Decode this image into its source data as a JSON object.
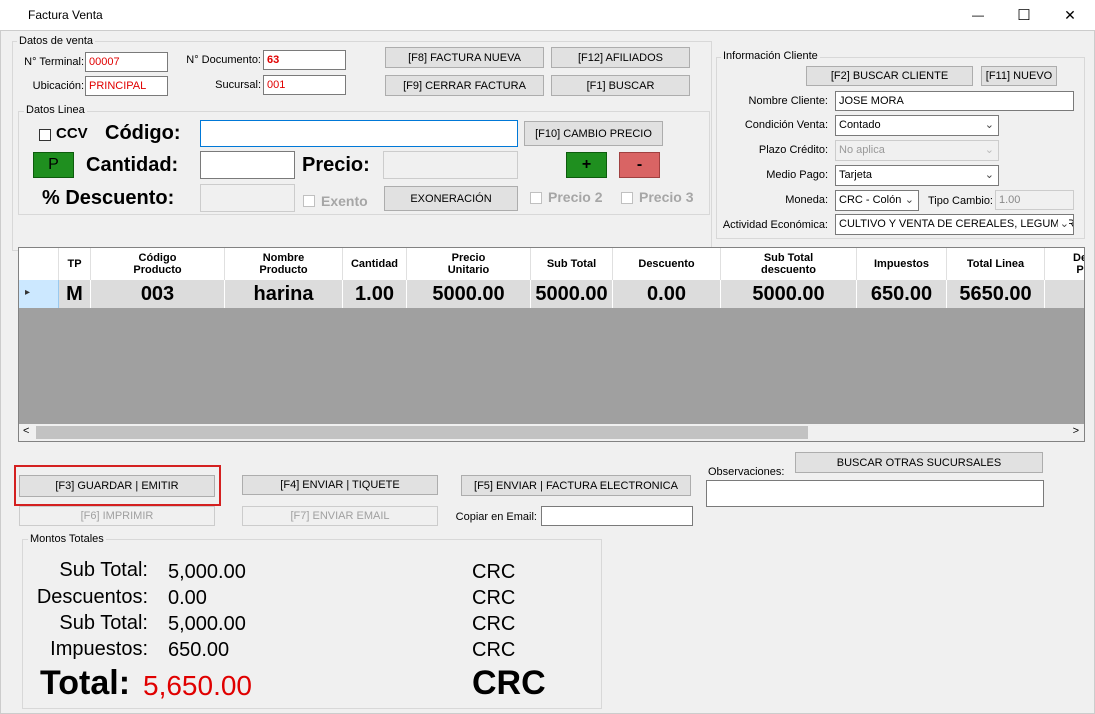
{
  "window": {
    "title": "Factura Venta",
    "icon": "app-icon",
    "minimize": "—",
    "maximize": "☐",
    "close": "✕"
  },
  "datos_venta": {
    "group_label": "Datos de venta",
    "terminal_label": "N° Terminal:",
    "terminal_value": "00007",
    "documento_label": "N° Documento:",
    "documento_value": "63",
    "ubicacion_label": "Ubicación:",
    "ubicacion_value": "PRINCIPAL",
    "sucursal_label": "Sucursal:",
    "sucursal_value": "001"
  },
  "toolbar": {
    "factura_nueva": "[F8] FACTURA NUEVA",
    "afiliados": "[F12] AFILIADOS",
    "cerrar_factura": "[F9] CERRAR FACTURA",
    "buscar": "[F1] BUSCAR"
  },
  "datos_linea": {
    "group_label": "Datos Linea",
    "ccv_label": "CCV",
    "codigo_label": "Código:",
    "codigo_value": "",
    "cambio_precio": "[F10] CAMBIO PRECIO",
    "p_button": "P",
    "cantidad_label": "Cantidad:",
    "cantidad_value": "",
    "precio_label": "Precio:",
    "precio_value": "",
    "plus_button": "+",
    "minus_button": "-",
    "descuento_label": "% Descuento:",
    "descuento_value": "",
    "exento_label": "Exento",
    "exoneracion": "EXONERACIÓN",
    "precio2_label": "Precio 2",
    "precio3_label": "Precio 3"
  },
  "cliente": {
    "group_label": "Información Cliente",
    "buscar_cliente": "[F2] BUSCAR CLIENTE",
    "nuevo": "[F11] NUEVO",
    "nombre_label": "Nombre Cliente:",
    "nombre_value": "JOSE  MORA",
    "condicion_label": "Condición Venta:",
    "condicion_value": "Contado",
    "plazo_label": "Plazo Crédito:",
    "plazo_value": "No aplica",
    "medio_label": "Medio Pago:",
    "medio_value": "Tarjeta",
    "moneda_label": "Moneda:",
    "moneda_value": "CRC - Colón",
    "tipo_cambio_label": "Tipo Cambio:",
    "tipo_cambio_value": "1.00",
    "actividad_label": "Actividad Económica:",
    "actividad_value": "CULTIVO Y VENTA DE CEREALES, LEGUMBRES"
  },
  "grid": {
    "columns": [
      "TP",
      "Código\nProducto",
      "Nombre\nProducto",
      "Cantidad",
      "Precio\nUnitario",
      "Sub Total",
      "Descuento",
      "Sub Total\ndescuento",
      "Impuestos",
      "Total Linea",
      "De\nP"
    ],
    "rows": [
      [
        "M",
        "003",
        "harina",
        "1.00",
        "5000.00",
        "5000.00",
        "0.00",
        "5000.00",
        "650.00",
        "5650.00",
        ""
      ]
    ],
    "scroll_left": "<",
    "scroll_right": ">",
    "row_marker": "▸"
  },
  "actions": {
    "guardar": "[F3] GUARDAR | EMITIR",
    "enviar_tiquete": "[F4] ENVIAR | TIQUETE",
    "enviar_factura": "[F5] ENVIAR | FACTURA ELECTRONICA",
    "imprimir": "[F6] IMPRIMIR",
    "enviar_email": "[F7] ENVIAR EMAIL",
    "copiar_label": "Copiar en Email:",
    "copiar_value": "",
    "observaciones_label": "Observaciones:",
    "observaciones_value": "",
    "buscar_sucursales": "BUSCAR OTRAS SUCURSALES"
  },
  "totales": {
    "group_label": "Montos Totales",
    "subtotal_label": "Sub Total:",
    "subtotal_value": "5,000.00",
    "descuentos_label": "Descuentos:",
    "descuentos_value": "0.00",
    "subtotal2_label": "Sub Total:",
    "subtotal2_value": "5,000.00",
    "impuestos_label": "Impuestos:",
    "impuestos_value": "650.00",
    "total_label": "Total:",
    "total_value": "5,650.00",
    "currency": "CRC"
  },
  "colors": {
    "total_red": "#e00000",
    "green_button": "#1f8f1f",
    "red_button": "#d96464",
    "highlight_border": "#d42020"
  }
}
